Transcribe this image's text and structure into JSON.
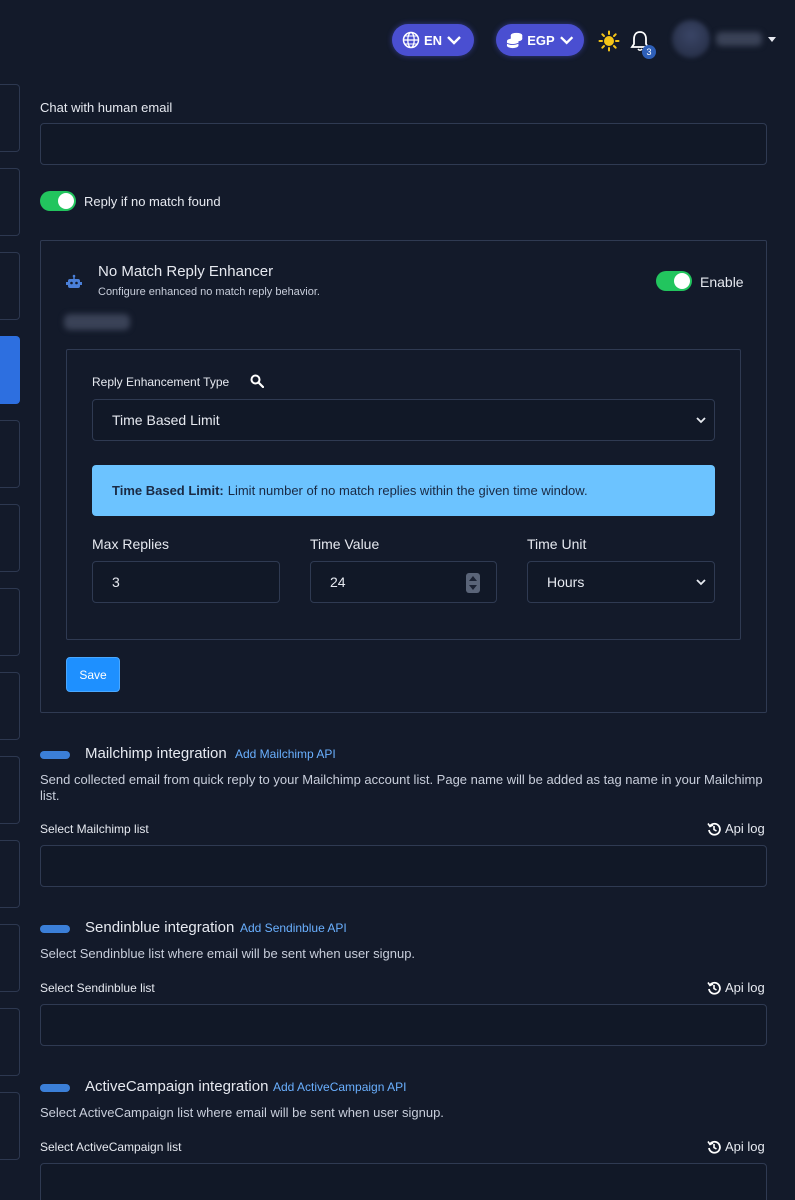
{
  "header": {
    "language": "EN",
    "currency": "EGP",
    "notifications_count": "3"
  },
  "chat_email": {
    "label": "Chat with human email",
    "value": ""
  },
  "reply_no_match": {
    "label": "Reply if no match found",
    "enabled": true
  },
  "enhancer": {
    "title": "No Match Reply Enhancer",
    "subtitle": "Configure enhanced no match reply behavior.",
    "enable_label": "Enable",
    "enabled": true,
    "type_label": "Reply Enhancement Type",
    "type_value": "Time Based Limit",
    "info_title": "Time Based Limit:",
    "info_text": "Limit number of no match replies within the given time window.",
    "max_replies_label": "Max Replies",
    "max_replies_value": "3",
    "time_value_label": "Time Value",
    "time_value_value": "24",
    "time_unit_label": "Time Unit",
    "time_unit_value": "Hours",
    "save_label": "Save"
  },
  "mailchimp": {
    "title": "Mailchimp integration",
    "link": "Add Mailchimp API",
    "description": "Send collected email from quick reply to your Mailchimp account list. Page name will be added as tag name in your Mailchimp list.",
    "select_label": "Select Mailchimp list",
    "api_log": "Api log"
  },
  "sendinblue": {
    "title": "Sendinblue integration",
    "link": "Add Sendinblue API",
    "description": "Select Sendinblue list where email will be sent when user signup.",
    "select_label": "Select Sendinblue list",
    "api_log": "Api log"
  },
  "activecampaign": {
    "title": "ActiveCampaign integration",
    "link": "Add ActiveCampaign API",
    "description": "Select ActiveCampaign list where email will be sent when user signup.",
    "select_label": "Select ActiveCampaign list",
    "api_log": "Api log"
  },
  "colors": {
    "background": "#131a2a",
    "accent_pill": "#4a4fd1",
    "toggle_on": "#22c55e",
    "primary": "#1e90ff",
    "info_bg": "#6cc3ff",
    "link": "#6ab0ff"
  }
}
